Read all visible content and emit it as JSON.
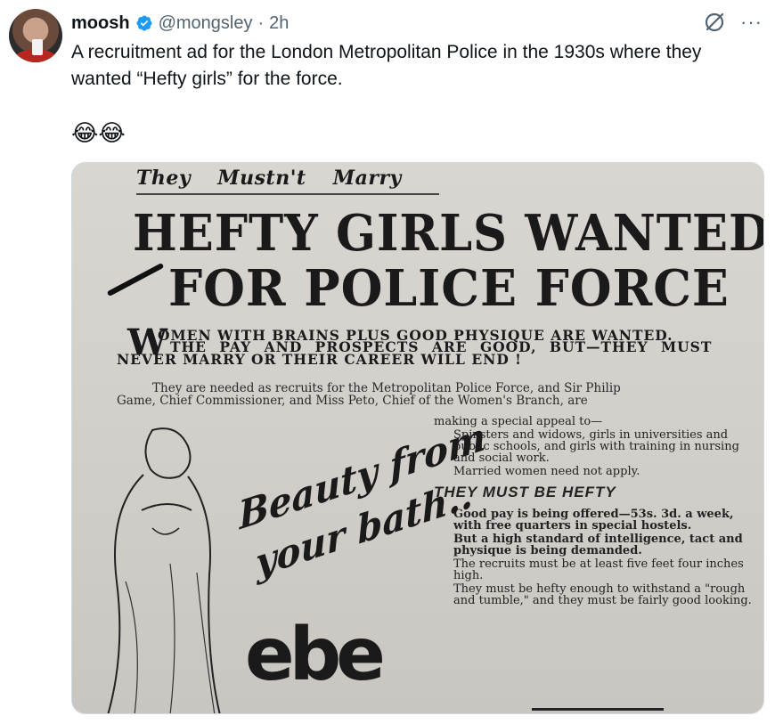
{
  "post": {
    "author_name": "moosh",
    "handle": "@mongsley",
    "separator": "·",
    "time": "2h",
    "text": "A recruitment ad for the London Metropolitan Police in the 1930s where they wanted “Hefty girls” for the force.",
    "emoji": "😂😂"
  },
  "icons": {
    "verified": "verified-badge-icon",
    "grok": "grok-icon",
    "more": "more-icon"
  },
  "colors": {
    "verified_blue": "#1d9bf0",
    "secondary_text": "#536471"
  },
  "clipping": {
    "kicker": "They Mustn't Marry",
    "headline_line1": "HEFTY GIRLS WANTED",
    "headline_line2": "FOR POLICE FORCE",
    "deck_dropcap": "W",
    "deck_line1": "OMEN WITH BRAINS PLUS GOOD PHYSIQUE ARE WANTED.",
    "deck_line2": "THE PAY AND PROSPECTS ARE GOOD, BUT—THEY MUST",
    "deck_line3": "NEVER MARRY OR THEIR CAREER WILL END !",
    "intro_line1": "They are needed as recruits for the Metropolitan Police Force, and Sir Philip",
    "intro_line2": "Game, Chief Commissioner, and Miss Peto, Chief of the Women's Branch, are",
    "p1": "making a special appeal to—",
    "p2": "Spinsters and widows, girls in universities and public schools, and girls with training in nursing and social work.",
    "p3": "Married women need not apply.",
    "subhead": "THEY MUST BE HEFTY",
    "p4": "Good pay is being offered—53s. 3d. a week, with free quarters in special hostels.",
    "p5": "But a high standard of intelligence, tact and physique is being demanded.",
    "p6": "The recruits must be at least five feet four inches high.",
    "p7": "They must be hefty enough to withstand a \"rough and tumble,\" and they must be fairly good looking.",
    "ad_script_line1": "Beauty from",
    "ad_script_line2": "your bath..",
    "ad_brand": "ebe"
  }
}
